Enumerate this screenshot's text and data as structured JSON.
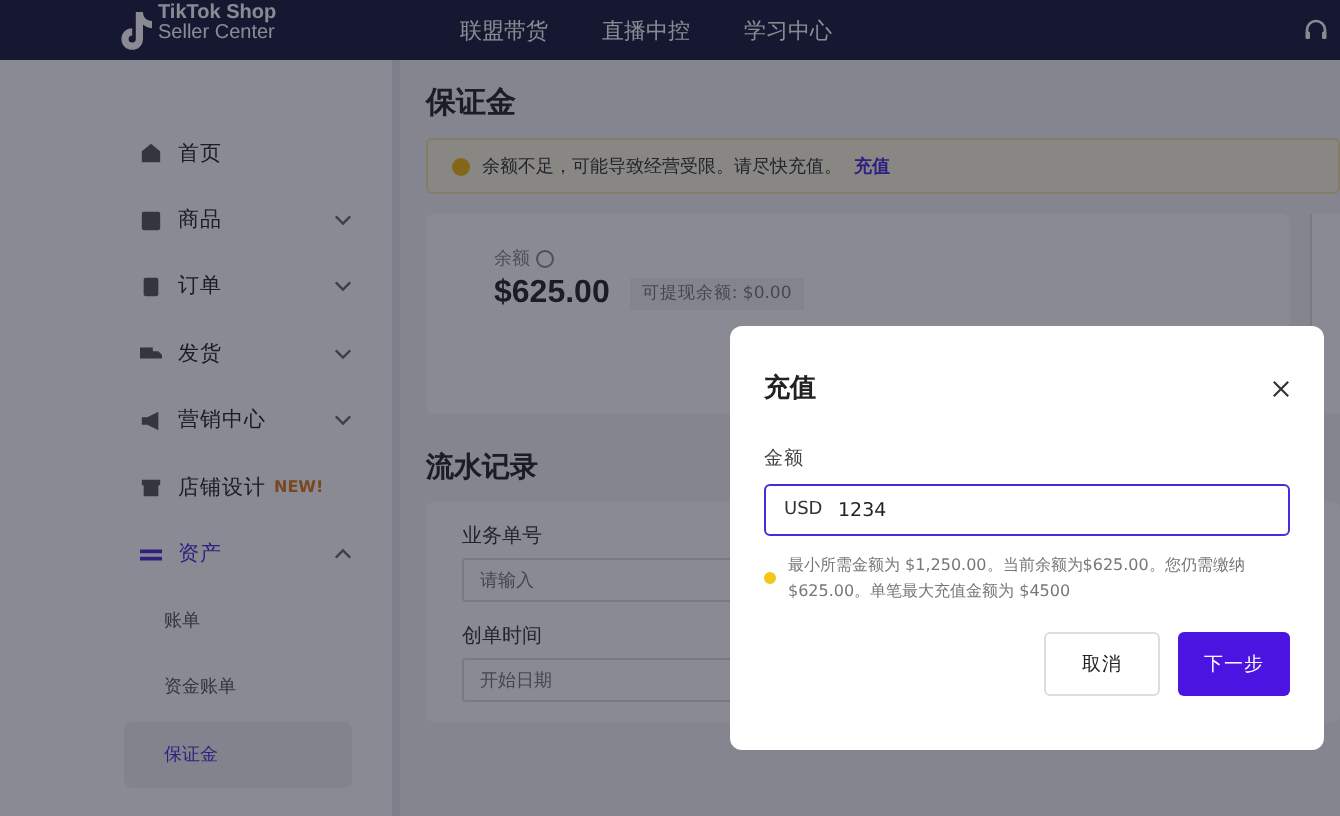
{
  "header": {
    "logo_line1": "TikTok Shop",
    "logo_line2": "Seller Center",
    "nav": [
      {
        "label": "联盟带货"
      },
      {
        "label": "直播中控"
      },
      {
        "label": "学习中心"
      }
    ]
  },
  "sidebar": {
    "items": [
      {
        "label": "首页",
        "selected": false
      },
      {
        "label": "商品",
        "expanded": false,
        "selected": false
      },
      {
        "label": "订单",
        "expanded": false,
        "selected": false
      },
      {
        "label": "发货",
        "expanded": false,
        "selected": false
      },
      {
        "label": "营销中心",
        "expanded": false,
        "selected": false
      },
      {
        "label": "店铺设计",
        "badge": "NEW!",
        "selected": false
      },
      {
        "label": "资产",
        "expanded": true,
        "selected": true,
        "children": [
          {
            "label": "账单",
            "selected": false
          },
          {
            "label": "资金账单",
            "selected": false
          },
          {
            "label": "保证金",
            "selected": true
          }
        ]
      }
    ]
  },
  "page": {
    "title": "保证金",
    "alert": {
      "text": "余额不足，可能导致经营受限。请尽快充值。",
      "link": "充值"
    },
    "balance": {
      "label": "余额",
      "amount": "$625.00",
      "withdrawable": "可提现余额: $0.00"
    },
    "records": {
      "title": "流水记录",
      "filters": [
        {
          "label": "业务单号",
          "placeholder": "请输入"
        },
        {
          "label": "创单时间",
          "placeholder": "开始日期"
        }
      ]
    }
  },
  "dialog": {
    "title": "充值",
    "field_label": "金额",
    "currency": "USD",
    "value": "1234",
    "hint": "最小所需金额为 $1,250.00。当前余额为$625.00。您仍需缴纳$625.00。单笔最大充值金额为 $4500",
    "buttons": [
      {
        "label": "取消",
        "kind": "secondary"
      },
      {
        "label": "下一步",
        "kind": "primary"
      }
    ]
  }
}
